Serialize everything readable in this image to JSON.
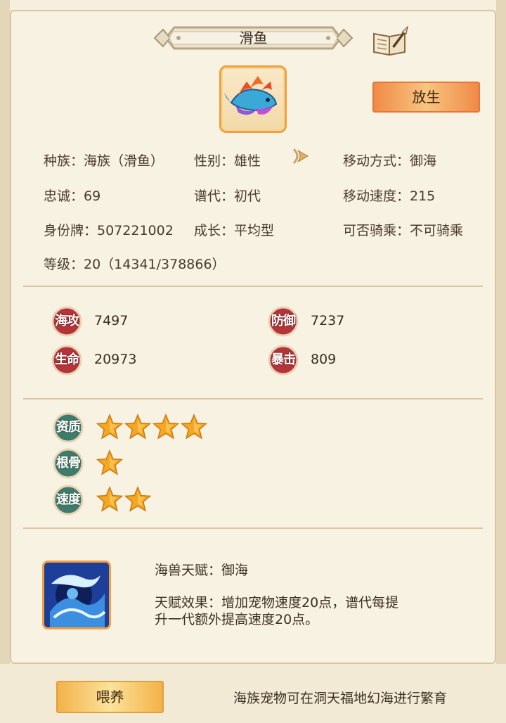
{
  "title": "滑鱼",
  "release_label": "放生",
  "info": {
    "race": "种族：海族（滑鱼）",
    "gender": "性别：雄性",
    "move_type": "移动方式：御海",
    "loyalty": "忠诚：69",
    "generation": "谱代：初代",
    "move_speed": "移动速度：215",
    "id_tag": "身份牌：507221002",
    "growth": "成长：平均型",
    "rideable": "可否骑乘：不可骑乘",
    "level": "等级：20（14341/378866）"
  },
  "stats": [
    {
      "label": "海攻",
      "value": "7497"
    },
    {
      "label": "防御",
      "value": "7237"
    },
    {
      "label": "生命",
      "value": "20973"
    },
    {
      "label": "暴击",
      "value": "809"
    }
  ],
  "ratings": [
    {
      "label": "资质",
      "stars": 4
    },
    {
      "label": "根骨",
      "stars": 1
    },
    {
      "label": "速度",
      "stars": 2
    }
  ],
  "talent": {
    "name": "海兽天赋：御海",
    "effect_line1": "天赋效果：增加宠物速度20点，谱代每提",
    "effect_line2": "升一代额外提高速度20点。"
  },
  "feed_label": "喂养",
  "tip": "海族宠物可在洞天福地幻海进行繁育",
  "icons": {
    "book": "book-quill-icon",
    "arrow": "arrow-right-icon",
    "pet": "fish-pet-icon",
    "skill": "water-wave-skill-icon",
    "star": "star-icon"
  },
  "colors": {
    "stat_badge": "#b3343a",
    "rating_badge": "#3f7a6a",
    "star": "#f5a623"
  }
}
